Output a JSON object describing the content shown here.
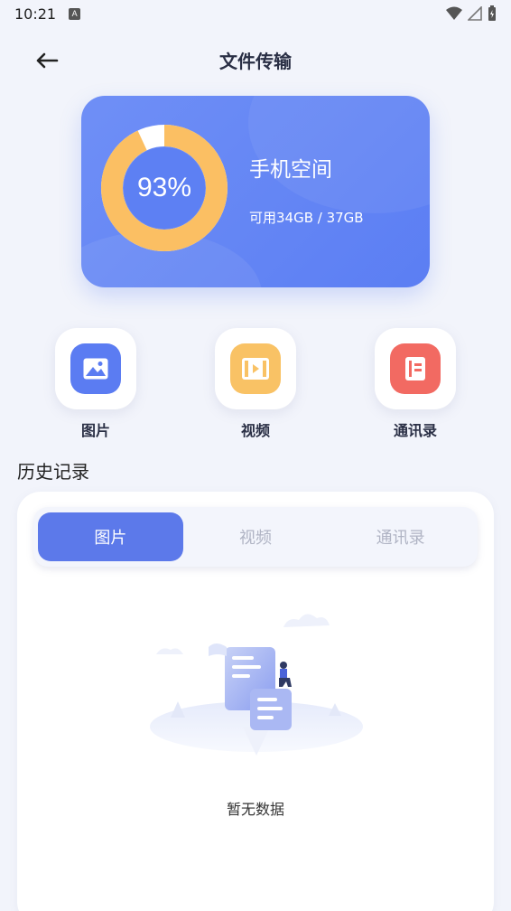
{
  "status": {
    "time": "10:21",
    "badge": "A"
  },
  "header": {
    "title": "文件传输"
  },
  "storage": {
    "percent_label": "93%",
    "used_fraction": 0.93,
    "title": "手机空间",
    "subtitle": "可用34GB / 37GB"
  },
  "categories": [
    {
      "label": "图片",
      "icon": "image-icon",
      "color": "#5b7cf2"
    },
    {
      "label": "视频",
      "icon": "video-icon",
      "color": "#f9c265"
    },
    {
      "label": "通讯录",
      "icon": "contacts-icon",
      "color": "#f26a62"
    }
  ],
  "history": {
    "title": "历史记录",
    "tabs": [
      "图片",
      "视频",
      "通讯录"
    ],
    "active_tab": "图片",
    "empty_text": "暂无数据"
  },
  "colors": {
    "accent": "#5c79ea",
    "ring": "#fbbf63",
    "background": "#f2f4fb"
  }
}
